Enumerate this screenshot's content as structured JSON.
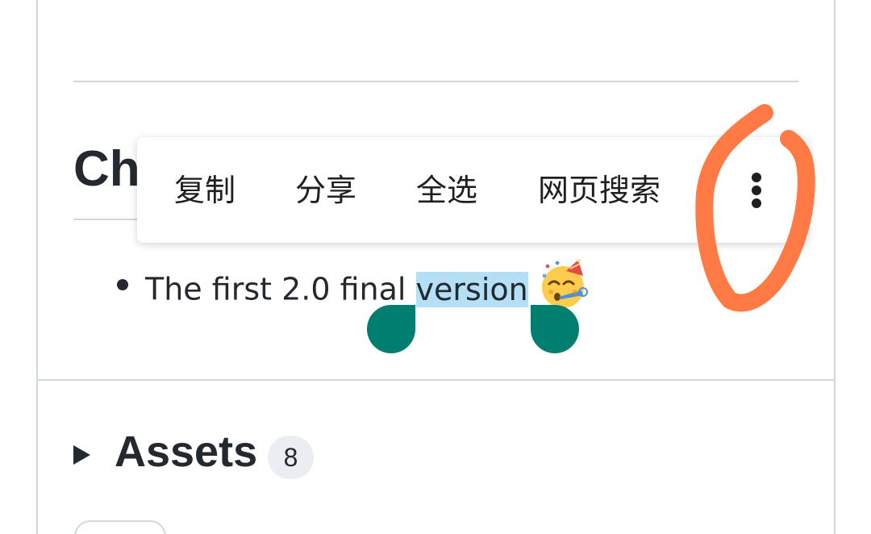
{
  "release": {
    "section_heading": "Ch",
    "changelog": {
      "text_before": "The first 2.0 final ",
      "selected_text": "version",
      "emoji_icon": "partying-face-icon"
    }
  },
  "context_menu": {
    "copy": "复制",
    "share": "分享",
    "select_all": "全选",
    "web_search": "网页搜索",
    "more_icon": "more-vertical-icon"
  },
  "assets": {
    "title": "Assets",
    "count": "8"
  },
  "colors": {
    "selection_highlight": "#b4dff5",
    "selection_handle": "#007e70",
    "annotation_scribble": "#ff7a45",
    "border": "#d0d7de"
  }
}
